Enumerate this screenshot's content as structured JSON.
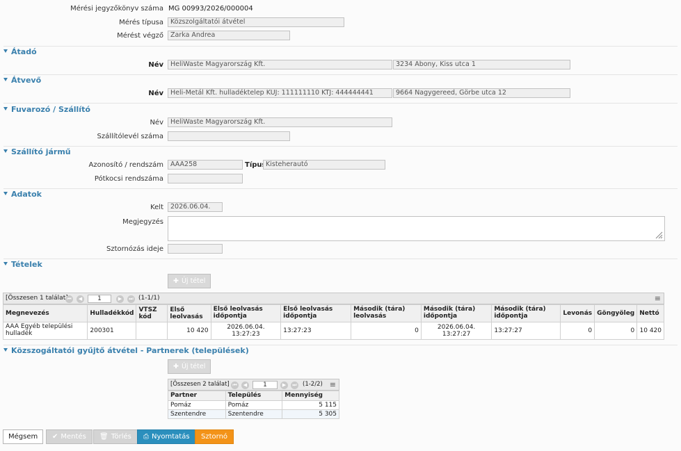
{
  "header": {
    "doc_no_label": "Mérési jegyzőkönyv száma",
    "doc_no_value": "MG 00993/2026/000004",
    "type_label": "Mérés típusa",
    "type_value": "Közszolgáltatói átvétel",
    "performer_label": "Mérést végző",
    "performer_value": "Zarka Andrea"
  },
  "atado": {
    "title": "Átadó",
    "name_label": "Név",
    "name_value": "HeliWaste Magyarország Kft.",
    "address_value": "3234 Abony, Kiss utca 1"
  },
  "atvevo": {
    "title": "Átvevő",
    "name_label": "Név",
    "name_value": "Heli-Metál Kft. hulladéktelep KÜJ: 111111110 KTJ: 444444441",
    "address_value": "9664 Nagygereed, Görbe utca 12"
  },
  "fuvarozo": {
    "title": "Fuvarozó / Szállító",
    "name_label": "Név",
    "name_value": "HeliWaste Magyarország Kft.",
    "waybill_label": "Szállítólevél száma",
    "waybill_value": ""
  },
  "jarmu": {
    "title": "Szállító jármű",
    "plate_label": "Azonosító / rendszám",
    "plate_value": "AAA258",
    "type_label": "Típus",
    "type_value": "Kisteherautó",
    "trailer_label": "Pótkocsi rendszáma",
    "trailer_value": ""
  },
  "adatok": {
    "title": "Adatok",
    "date_label": "Kelt",
    "date_value": "2026.06.04.",
    "note_label": "Megjegyzés",
    "note_value": "",
    "storno_label": "Sztornózás ideje",
    "storno_value": ""
  },
  "tetelek": {
    "title": "Tételek",
    "new_button": "Új tétel",
    "summary": "[Összesen 1 találat]",
    "page_input": "1",
    "page_info": "(1-1/1)",
    "columns": [
      "Megnevezés",
      "Hulladékkód",
      "VTSZ kód",
      "Első leolvasás",
      "Első leolvasás időpontja",
      "Első leolvasás időpontja",
      "Második (tára) leolvasás",
      "Második (tára) időpontja",
      "Második (tára) időpontja",
      "Levonás",
      "Göngyöleg",
      "Nettó"
    ],
    "rows": [
      [
        "AAA Egyéb települési hulladék",
        "200301",
        "",
        "10 420",
        "2026.06.04. 13:27:23",
        "13:27:23",
        "0",
        "2026.06.04. 13:27:27",
        "13:27:27",
        "0",
        "0",
        "10 420"
      ]
    ]
  },
  "partnerek": {
    "title": "Közszogáltatói gyűjtő átvétel - Partnerek (települések)",
    "new_button": "Új tétel",
    "summary": "[Összesen 2 találat]",
    "page_input": "1",
    "page_info": "(1-2/2)",
    "columns": [
      "Partner",
      "Település",
      "Mennyiség"
    ],
    "rows": [
      [
        "Pomáz",
        "Pomáz",
        "5 115"
      ],
      [
        "Szentendre",
        "Szentendre",
        "5 305"
      ]
    ]
  },
  "footer": {
    "cancel": "Mégsem",
    "save": "Mentés",
    "delete": "Törlés",
    "print": "Nyomtatás",
    "storno": "Sztornó"
  },
  "colors": {
    "section": "#3a80ad",
    "print_button": "#2b8fbd",
    "storno_button": "#f39318"
  }
}
